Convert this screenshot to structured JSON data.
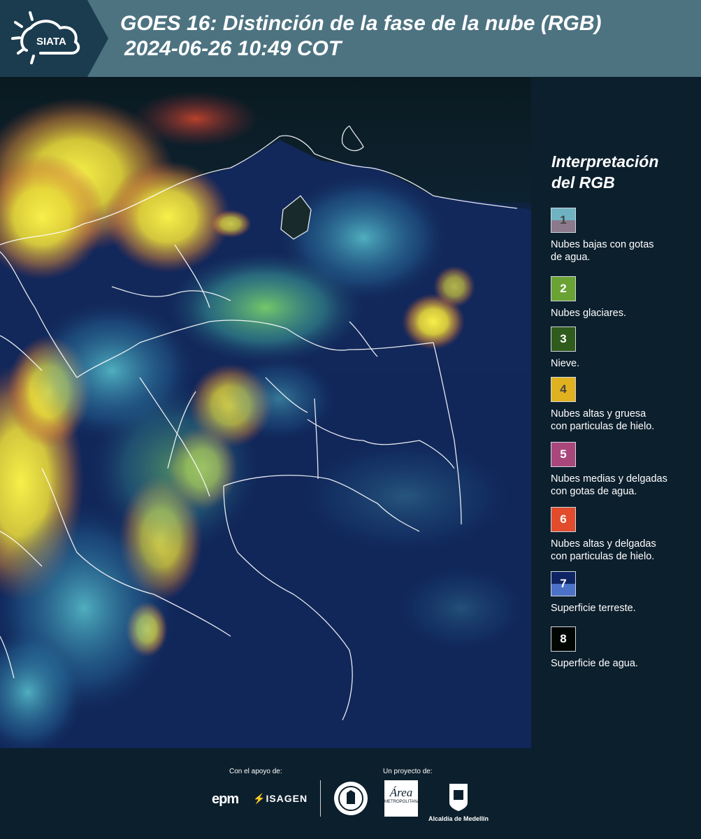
{
  "header": {
    "logo_text": "SIATA",
    "title_line1": "GOES 16: Distinción de la fase de la nube (RGB)",
    "title_line2": "2024-06-26 10:49 COT"
  },
  "legend": {
    "title_line1": "Interpretación",
    "title_line2": "del RGB",
    "items": [
      {
        "number": "1",
        "label_line1": "Nubes bajas con gotas",
        "label_line2": "de agua.",
        "color_top": "#6fb3c3",
        "color_bottom": "#8b7a8c",
        "number_color": "#444444"
      },
      {
        "number": "2",
        "label_line1": "Nubes glaciares.",
        "label_line2": "",
        "color_top": "#6aa233",
        "color_bottom": "#6aa233",
        "number_color": "#ffffff"
      },
      {
        "number": "3",
        "label_line1": "Nieve.",
        "label_line2": "",
        "color_top": "#2f5b1c",
        "color_bottom": "#2f5b1c",
        "number_color": "#ffffff"
      },
      {
        "number": "4",
        "label_line1": "Nubes altas y gruesa",
        "label_line2": "con particulas de hielo.",
        "color_top": "#e1b21f",
        "color_bottom": "#e1b21f",
        "number_color": "#444444"
      },
      {
        "number": "5",
        "label_line1": "Nubes medias y delgadas",
        "label_line2": "con gotas de agua.",
        "color_top": "#a9477a",
        "color_bottom": "#a9477a",
        "number_color": "#ffffff"
      },
      {
        "number": "6",
        "label_line1": "Nubes altas y delgadas",
        "label_line2": "con particulas de hielo.",
        "color_top": "#e24b2c",
        "color_bottom": "#e24b2c",
        "number_color": "#ffffff"
      },
      {
        "number": "7",
        "label_line1": "Superficie terreste.",
        "label_line2": "",
        "color_top": "#0f2463",
        "color_bottom": "#4b72c8",
        "number_color": "#ffffff"
      },
      {
        "number": "8",
        "label_line1": "Superficie de agua.",
        "label_line2": "",
        "color_top": "#020603",
        "color_bottom": "#020603",
        "number_color": "#ffffff"
      }
    ]
  },
  "footer": {
    "support_label": "Con el apoyo de:",
    "project_label": "Un proyecto de:",
    "sponsor1": "epm",
    "sponsor2": "ISAGEN",
    "partner_area_text": "Área",
    "partner_area_subtext": "METROPOLITANA",
    "partner_alcaldia": "Alcaldía de Medellín"
  }
}
